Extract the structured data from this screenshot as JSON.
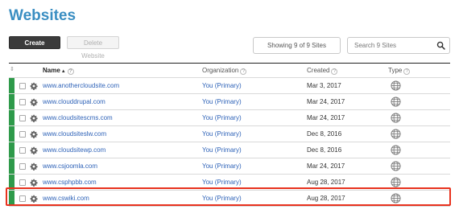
{
  "page": {
    "title": "Websites"
  },
  "toolbar": {
    "create_label": "Create Website",
    "delete_label": "Delete Website",
    "showing_text": "Showing 9 of 9 Sites",
    "search_placeholder": "Search 9 Sites"
  },
  "table": {
    "columns": {
      "sort": "⇕",
      "name": "Name",
      "organization": "Organization",
      "created": "Created",
      "type": "Type"
    },
    "rows": [
      {
        "name": "www.anothercloudsite.com",
        "org": "You (Primary)",
        "created": "Mar 3, 2017"
      },
      {
        "name": "www.clouddrupal.com",
        "org": "You (Primary)",
        "created": "Mar 24, 2017"
      },
      {
        "name": "www.cloudsitescms.com",
        "org": "You (Primary)",
        "created": "Mar 24, 2017"
      },
      {
        "name": "www.cloudsiteslw.com",
        "org": "You (Primary)",
        "created": "Dec 8, 2016"
      },
      {
        "name": "www.cloudsitewp.com",
        "org": "You (Primary)",
        "created": "Dec 8, 2016"
      },
      {
        "name": "www.csjoomla.com",
        "org": "You (Primary)",
        "created": "Mar 24, 2017"
      },
      {
        "name": "www.csphpbb.com",
        "org": "You (Primary)",
        "created": "Aug 28, 2017"
      },
      {
        "name": "www.cswiki.com",
        "org": "You (Primary)",
        "created": "Aug 28, 2017"
      }
    ]
  },
  "colors": {
    "title": "#3a8ec2",
    "link": "#2f63b8",
    "status": "#2e9a4a",
    "highlight": "#e8321e"
  },
  "icons": {
    "row_settings": "gear-icon",
    "row_type": "globe-icon",
    "search": "search-icon",
    "help": "help-icon"
  }
}
